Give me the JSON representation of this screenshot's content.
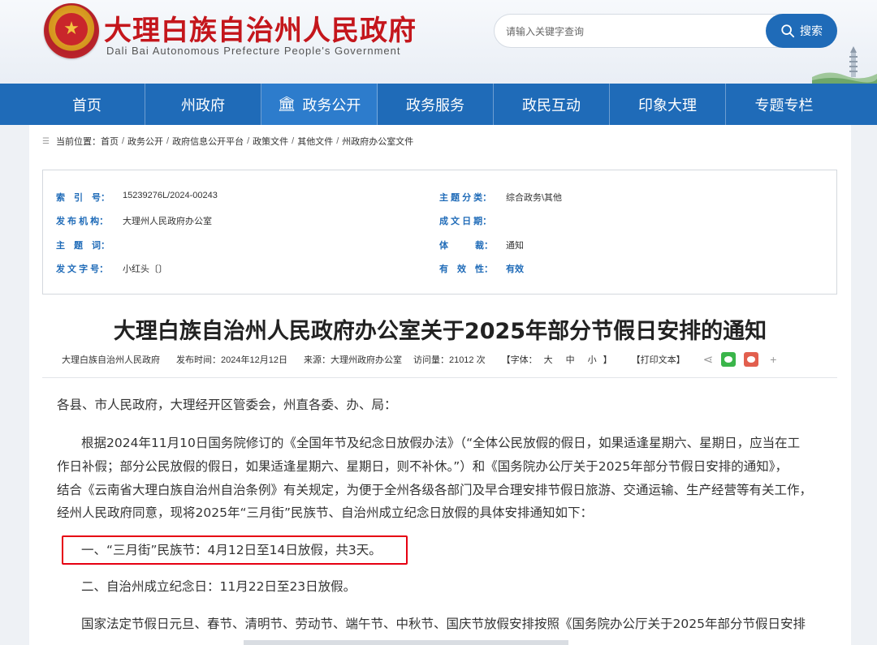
{
  "header": {
    "title": "大理白族自治州人民政府",
    "subtitle": "Dali Bai Autonomous Prefecture People's Government",
    "search_placeholder": "请输入关键字查询",
    "search_label": "搜索"
  },
  "nav": {
    "items": [
      {
        "label": "首页"
      },
      {
        "label": "州政府"
      },
      {
        "label": "政务公开"
      },
      {
        "label": "政务服务"
      },
      {
        "label": "政民互动"
      },
      {
        "label": "印象大理"
      },
      {
        "label": "专题专栏"
      }
    ],
    "active": "政务公开"
  },
  "breadcrumb": {
    "prefix": "当前位置：",
    "items": [
      "首页",
      "政务公开",
      "政府信息公开平台",
      "政策文件",
      "其他文件",
      "州政府办公室文件"
    ],
    "separator": "/"
  },
  "meta": {
    "index_label": "索　引　号：",
    "index_value": "15239276L/2024-00243",
    "category_label": "主 题 分 类：",
    "category_value": "综合政务\\其他",
    "publisher_label": "发 布 机 构：",
    "publisher_value": "大理州人民政府办公室",
    "date_label": "成 文 日 期：",
    "date_value": "",
    "keyword_label": "主　题　词：",
    "keyword_value": "",
    "genre_label": "体　　　裁：",
    "genre_value": "通知",
    "docno_label": "发 文 字 号：",
    "docno_value": "小红头〔〕",
    "validity_label": "有　效　性：",
    "validity_value": "有效"
  },
  "document": {
    "title": "大理白族自治州人民政府办公室关于2025年部分节假日安排的通知",
    "author": "大理白族自治州人民政府",
    "publish_label": "发布时间：",
    "publish_date": "2024年12月12日",
    "source_label": "来源：",
    "source": "大理州政府办公室",
    "visits_label": "访问量：",
    "visits": "21012 次",
    "font_label": "【字体：",
    "font_large": "大",
    "font_medium": "中",
    "font_small": "小",
    "font_close": "】",
    "print_label": "【打印文本】",
    "plus": "+",
    "addressee": "各县、市人民政府，大理经开区管委会，州直各委、办、局：",
    "body_line1": "根据2024年11月10日国务院修订的《全国年节及纪念日放假办法》（“全体公民放假的假日，如果适逢星期六、星期日，应当在工",
    "body_line2": "作日补假；部分公民放假的假日，如果适逢星期六、星期日，则不补休。”）和《国务院办公厅关于2025年部分节假日安排的通知》，",
    "body_line3": "结合《云南省大理白族自治州自治条例》有关规定，为便于全州各级各部门及早合理安排节假日旅游、交通运输、生产经营等有关工作，",
    "body_line4": "经州人民政府同意，现将2025年“三月街”民族节、自治州成立纪念日放假的具体安排通知如下：",
    "item1": "一、“三月街”民族节：4月12日至14日放假，共3天。",
    "item2": "二、自治州成立纪念日：11月22日至23日放假。",
    "last_line": "国家法定节假日元旦、春节、清明节、劳动节、端午节、中秋节、国庆节放假安排按照《国务院办公厅关于2025年部分节假日安排"
  },
  "colors": {
    "brand_red": "#c4161c",
    "nav_blue": "#1f6bb8",
    "label_blue": "#1f6bb8",
    "highlight_red": "#e60012"
  }
}
